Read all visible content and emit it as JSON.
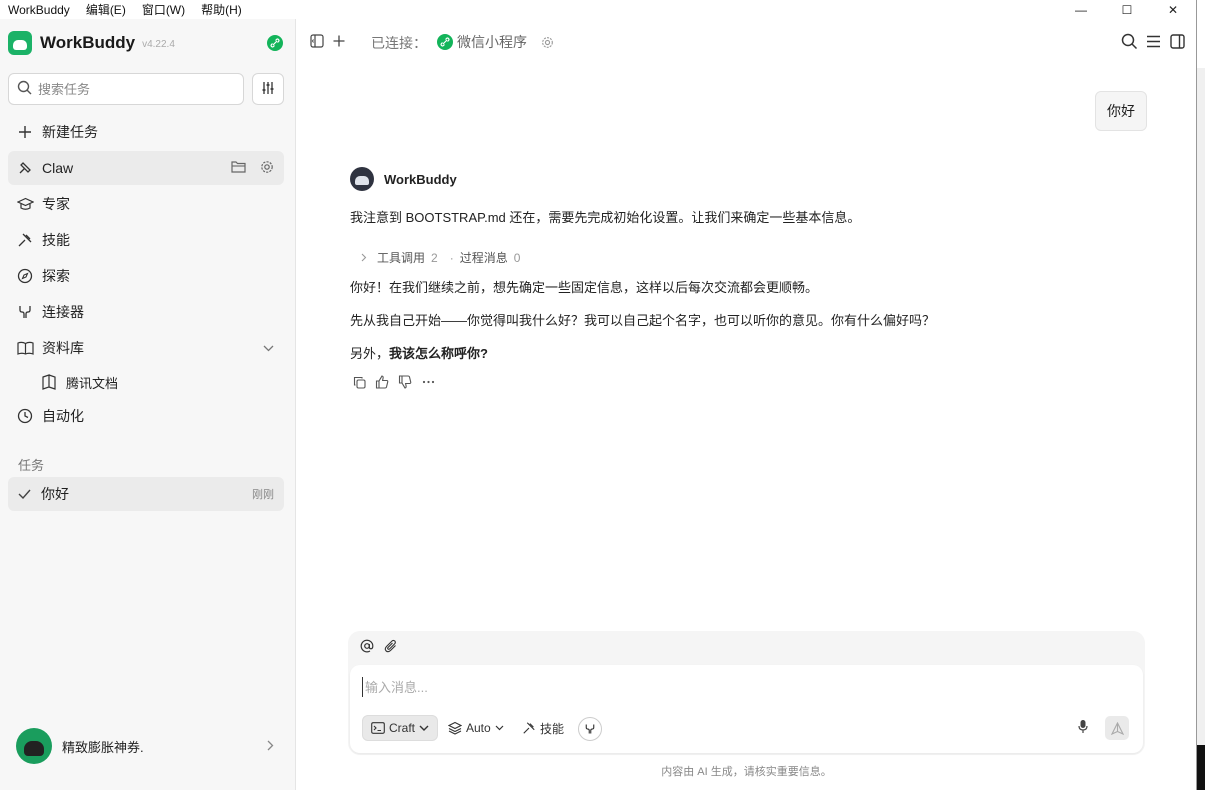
{
  "menubar": {
    "app": "WorkBuddy",
    "edit": "编辑(E)",
    "window": "窗口(W)",
    "help": "帮助(H)"
  },
  "window_controls": {
    "minimize": "—",
    "maximize": "☐",
    "close": "✕"
  },
  "sidebar": {
    "brand": "WorkBuddy",
    "version": "v4.22.4",
    "search_placeholder": "搜索任务",
    "new_task": "新建任务",
    "nav": {
      "claw": "Claw",
      "experts": "专家",
      "skills": "技能",
      "explore": "探索",
      "connectors": "连接器",
      "library": "资料库",
      "tencent_docs": "腾讯文档",
      "automation": "自动化"
    },
    "tasks_section": "任务",
    "tasks": [
      {
        "title": "你好",
        "time": "刚刚"
      }
    ],
    "user": {
      "name": "精致膨胀神券."
    }
  },
  "topbar": {
    "connected_label": "已连接：",
    "connector_name": "微信小程序"
  },
  "chat": {
    "user_message": "你好",
    "assistant_name": "WorkBuddy",
    "line1": "我注意到 BOOTSTRAP.md 还在，需要先完成初始化设置。让我们来确定一些基本信息。",
    "tool_calls_label": "工具调用",
    "tool_calls_count": "2",
    "process_label": "过程消息",
    "process_count": "0",
    "line2": "你好！在我们继续之前，想先确定一些固定信息，这样以后每次交流都会更顺畅。",
    "line3": "先从我自己开始——你觉得叫我什么好？我可以自己起个名字，也可以听你的意见。你有什么偏好吗？",
    "line4_prefix": "另外，",
    "line4_bold": "我该怎么称呼你?"
  },
  "composer": {
    "placeholder": "输入消息...",
    "mode": "Craft",
    "model": "Auto",
    "skills": "技能"
  },
  "footer": {
    "disclaimer": "内容由 AI 生成，请核实重要信息。"
  }
}
